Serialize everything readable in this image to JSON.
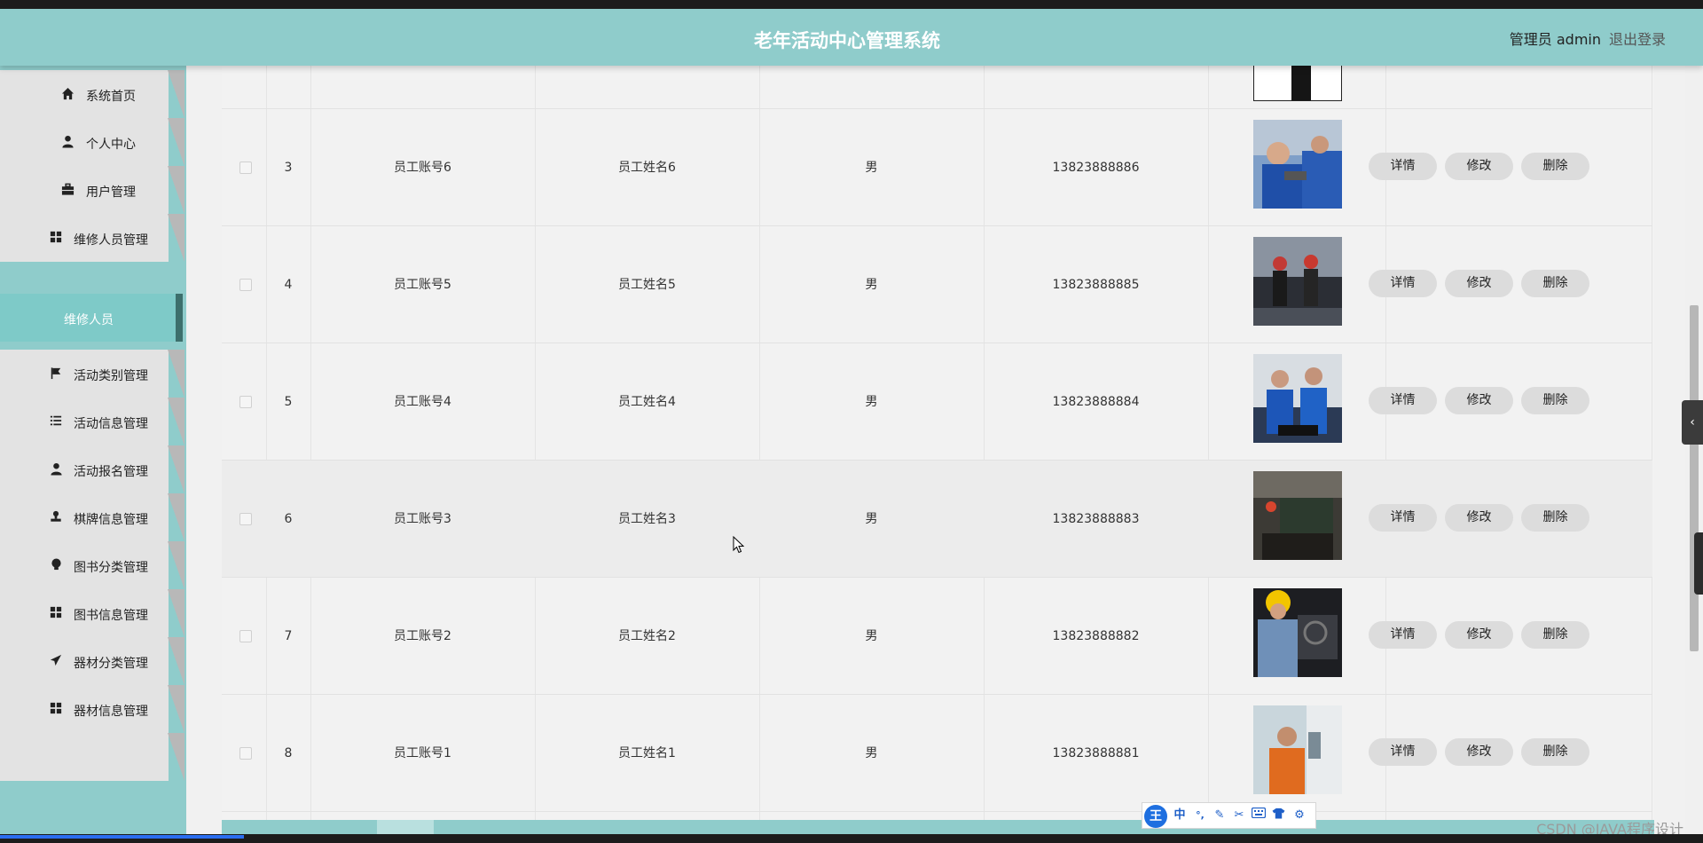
{
  "header": {
    "title": "老年活动中心管理系统",
    "admin_label": "管理员 admin",
    "logout_label": "退出登录"
  },
  "sidebar": {
    "items": [
      {
        "label": "系统首页",
        "icon": "home-icon"
      },
      {
        "label": "个人中心",
        "icon": "user-icon"
      },
      {
        "label": "用户管理",
        "icon": "briefcase-icon"
      },
      {
        "label": "维修人员管理",
        "icon": "grid-icon"
      },
      {
        "label": "维修人员",
        "icon": "",
        "active": true
      },
      {
        "label": "活动类别管理",
        "icon": "flag-icon"
      },
      {
        "label": "活动信息管理",
        "icon": "list-icon"
      },
      {
        "label": "活动报名管理",
        "icon": "user-icon"
      },
      {
        "label": "棋牌信息管理",
        "icon": "stamp-icon"
      },
      {
        "label": "图书分类管理",
        "icon": "bulb-icon"
      },
      {
        "label": "图书信息管理",
        "icon": "grid-icon"
      },
      {
        "label": "器材分类管理",
        "icon": "send-icon"
      },
      {
        "label": "器材信息管理",
        "icon": "grid-icon"
      }
    ]
  },
  "table": {
    "actions": {
      "detail": "详情",
      "edit": "修改",
      "delete": "删除"
    },
    "rows": [
      {
        "index": "3",
        "account": "员工账号6",
        "name": "员工姓名6",
        "gender": "男",
        "phone": "13823888886"
      },
      {
        "index": "4",
        "account": "员工账号5",
        "name": "员工姓名5",
        "gender": "男",
        "phone": "13823888885"
      },
      {
        "index": "5",
        "account": "员工账号4",
        "name": "员工姓名4",
        "gender": "男",
        "phone": "13823888884"
      },
      {
        "index": "6",
        "account": "员工账号3",
        "name": "员工姓名3",
        "gender": "男",
        "phone": "13823888883"
      },
      {
        "index": "7",
        "account": "员工账号2",
        "name": "员工姓名2",
        "gender": "男",
        "phone": "13823888882"
      },
      {
        "index": "8",
        "account": "员工账号1",
        "name": "员工姓名1",
        "gender": "男",
        "phone": "13823888881"
      }
    ]
  },
  "ime": {
    "logo": "王",
    "lang": "中",
    "punct": "°,"
  },
  "watermark": "CSDN @JAVA程序设计",
  "colors": {
    "accent": "#8fcccb",
    "active_bar": "#3d6f6c",
    "ime_blue": "#1e6fe0"
  }
}
